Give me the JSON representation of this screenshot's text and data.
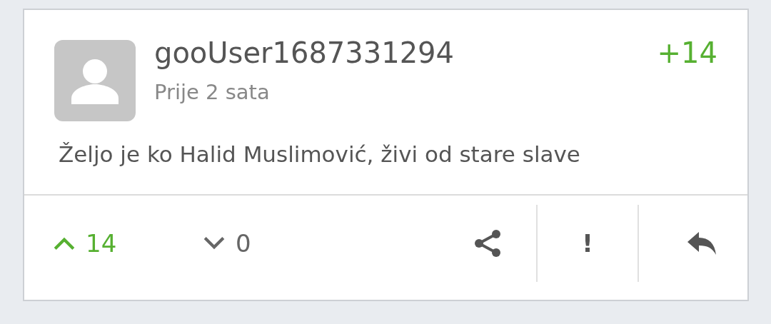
{
  "comment": {
    "username": "gooUser1687331294",
    "score": "+14",
    "time": "Prije 2 sata",
    "text": "Željo je ko Halid Muslimović, živi od stare slave"
  },
  "actions": {
    "upvotes": "14",
    "upvoted": true,
    "downvotes": "0",
    "downvoted": false,
    "report": "!"
  }
}
